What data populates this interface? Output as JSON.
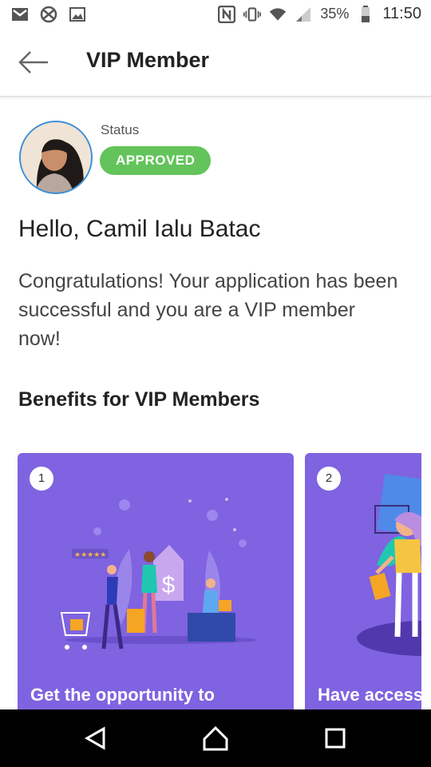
{
  "status_bar": {
    "battery_pct": "35%",
    "time": "11:50",
    "icons": [
      "gmail-icon",
      "vpn-icon",
      "gallery-icon",
      "nfc-icon",
      "vibrate-icon",
      "wifi-icon",
      "signal-icon",
      "battery-icon"
    ]
  },
  "header": {
    "title": "VIP Member",
    "back_icon": "arrow-left-icon"
  },
  "profile": {
    "status_label": "Status",
    "status_value": "APPROVED",
    "status_color": "#63c45b"
  },
  "greeting": "Hello, Camil Ialu Batac",
  "message": "Congratulations! Your application has been successful and you are a VIP member now!",
  "benefits": {
    "title": "Benefits for VIP Members",
    "card_color": "#7f63e0",
    "cards": [
      {
        "number": "1",
        "title": "Get the opportunity to"
      },
      {
        "number": "2",
        "title": "Have access"
      }
    ]
  },
  "nav": {
    "icons": [
      "back-triangle-icon",
      "home-icon",
      "recents-icon"
    ]
  }
}
